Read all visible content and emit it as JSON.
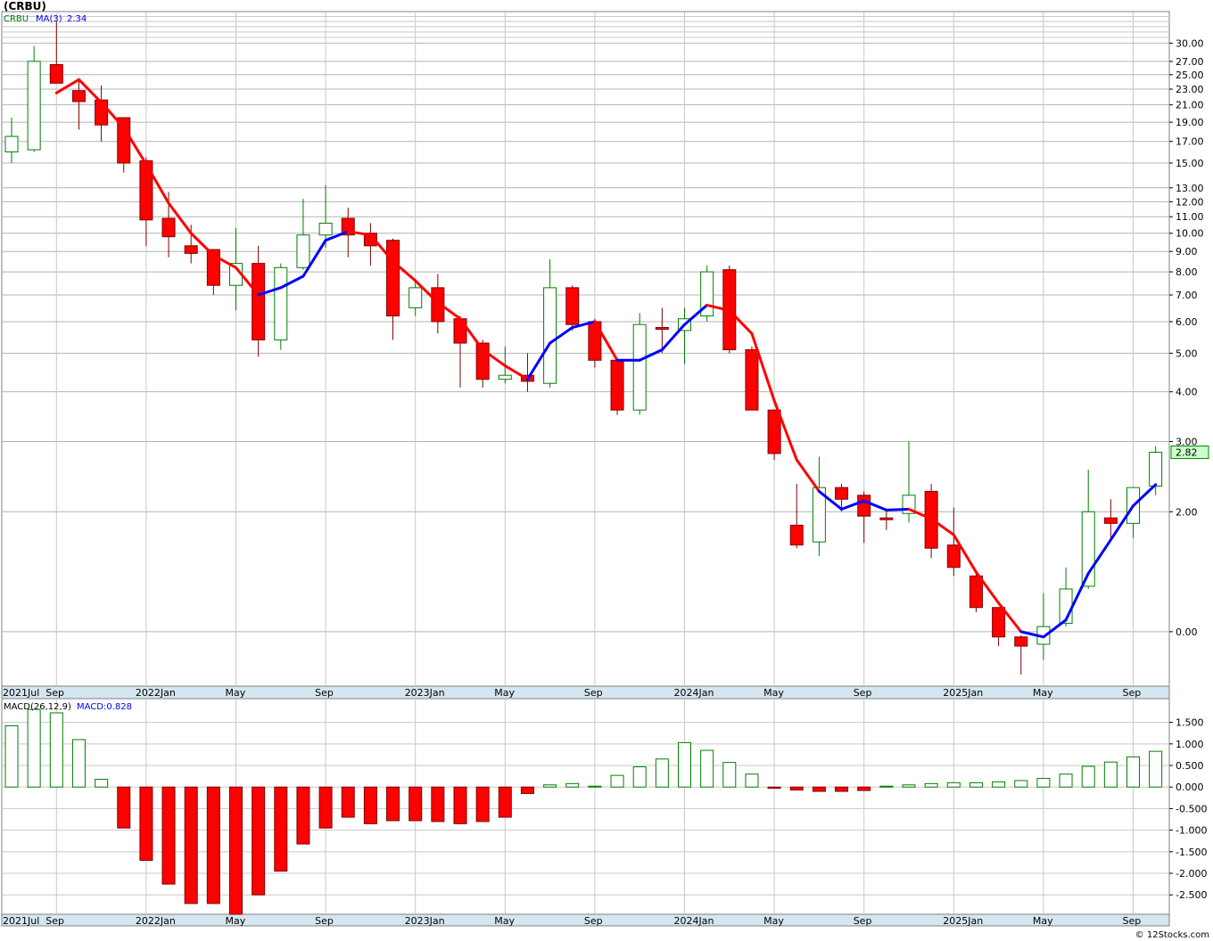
{
  "header": {
    "title": "(CRBU)"
  },
  "footer": {
    "credit": "© 12Stocks.com"
  },
  "chart_data": [
    {
      "type": "candlestick",
      "symbol": "CRBU",
      "interval": "monthly",
      "scale": "log",
      "legend": {
        "symbol_label": "CRBU",
        "ma_label": "MA(3)",
        "ma_value": "2.34"
      },
      "last_price_label": "2.82",
      "colors": {
        "down": "#ff0000",
        "up": "#008000",
        "ma_up": "#0000ff",
        "ma_down": "#ff0000"
      },
      "y_ticks": [
        {
          "v": 30.0,
          "label": "30.00"
        },
        {
          "v": 27.0,
          "label": "27.00"
        },
        {
          "v": 25.0,
          "label": "25.00"
        },
        {
          "v": 23.0,
          "label": "23.00"
        },
        {
          "v": 21.0,
          "label": "21.00"
        },
        {
          "v": 19.0,
          "label": "19.00"
        },
        {
          "v": 17.0,
          "label": "17.00"
        },
        {
          "v": 15.0,
          "label": "15.00"
        },
        {
          "v": 13.0,
          "label": "13.00"
        },
        {
          "v": 12.0,
          "label": "12.00"
        },
        {
          "v": 11.0,
          "label": "11.00"
        },
        {
          "v": 10.0,
          "label": "10.00"
        },
        {
          "v": 9.0,
          "label": "9.00"
        },
        {
          "v": 8.0,
          "label": "8.00"
        },
        {
          "v": 7.0,
          "label": "7.00"
        },
        {
          "v": 6.0,
          "label": "6.00"
        },
        {
          "v": 5.0,
          "label": "5.00"
        },
        {
          "v": 4.0,
          "label": "4.00"
        },
        {
          "v": 3.0,
          "label": "3.00"
        },
        {
          "v": 2.0,
          "label": "2.00"
        },
        {
          "v": 1.0,
          "label": "0.00"
        }
      ],
      "x_labels": [
        {
          "index": 0,
          "label": "2021Jul"
        },
        {
          "index": 2,
          "label": "Sep"
        },
        {
          "index": 6,
          "label": "2022Jan"
        },
        {
          "index": 10,
          "label": "May"
        },
        {
          "index": 14,
          "label": "Sep"
        },
        {
          "index": 18,
          "label": "2023Jan"
        },
        {
          "index": 22,
          "label": "May"
        },
        {
          "index": 26,
          "label": "Sep"
        },
        {
          "index": 30,
          "label": "2024Jan"
        },
        {
          "index": 34,
          "label": "May"
        },
        {
          "index": 38,
          "label": "Sep"
        },
        {
          "index": 42,
          "label": "2025Jan"
        },
        {
          "index": 46,
          "label": "May"
        },
        {
          "index": 50,
          "label": "Sep"
        }
      ],
      "candles": [
        {
          "o": 16.0,
          "h": 19.5,
          "l": 15.0,
          "c": 17.5
        },
        {
          "o": 16.2,
          "h": 29.5,
          "l": 16.0,
          "c": 27.0
        },
        {
          "o": 26.5,
          "h": 34.0,
          "l": 23.8,
          "c": 23.8
        },
        {
          "o": 22.8,
          "h": 24.5,
          "l": 18.2,
          "c": 21.4
        },
        {
          "o": 21.6,
          "h": 23.5,
          "l": 17.0,
          "c": 18.7
        },
        {
          "o": 19.5,
          "h": 19.5,
          "l": 14.2,
          "c": 15.0
        },
        {
          "o": 15.2,
          "h": 15.5,
          "l": 9.3,
          "c": 10.8
        },
        {
          "o": 10.9,
          "h": 12.7,
          "l": 8.7,
          "c": 9.8
        },
        {
          "o": 9.3,
          "h": 10.5,
          "l": 8.4,
          "c": 8.9
        },
        {
          "o": 9.1,
          "h": 9.1,
          "l": 7.0,
          "c": 7.4
        },
        {
          "o": 7.4,
          "h": 10.3,
          "l": 6.4,
          "c": 8.4
        },
        {
          "o": 8.4,
          "h": 9.3,
          "l": 4.9,
          "c": 5.4
        },
        {
          "o": 5.4,
          "h": 8.4,
          "l": 5.1,
          "c": 8.2
        },
        {
          "o": 8.2,
          "h": 12.2,
          "l": 8.1,
          "c": 9.9
        },
        {
          "o": 9.9,
          "h": 13.2,
          "l": 9.2,
          "c": 10.6
        },
        {
          "o": 10.9,
          "h": 11.6,
          "l": 8.7,
          "c": 9.9
        },
        {
          "o": 10.0,
          "h": 10.6,
          "l": 8.3,
          "c": 9.3
        },
        {
          "o": 9.6,
          "h": 9.7,
          "l": 5.4,
          "c": 6.2
        },
        {
          "o": 6.5,
          "h": 7.7,
          "l": 6.2,
          "c": 7.3
        },
        {
          "o": 7.3,
          "h": 7.9,
          "l": 5.6,
          "c": 6.0
        },
        {
          "o": 6.1,
          "h": 6.2,
          "l": 4.1,
          "c": 5.3
        },
        {
          "o": 5.3,
          "h": 5.4,
          "l": 4.1,
          "c": 4.3
        },
        {
          "o": 4.3,
          "h": 5.2,
          "l": 4.2,
          "c": 4.4
        },
        {
          "o": 4.4,
          "h": 5.0,
          "l": 4.0,
          "c": 4.25
        },
        {
          "o": 4.2,
          "h": 8.6,
          "l": 4.1,
          "c": 7.3
        },
        {
          "o": 7.3,
          "h": 7.4,
          "l": 5.7,
          "c": 5.9
        },
        {
          "o": 6.0,
          "h": 6.1,
          "l": 4.6,
          "c": 4.8
        },
        {
          "o": 4.8,
          "h": 4.8,
          "l": 3.5,
          "c": 3.6
        },
        {
          "o": 3.6,
          "h": 6.3,
          "l": 3.5,
          "c": 5.9
        },
        {
          "o": 5.8,
          "h": 6.5,
          "l": 5.0,
          "c": 5.75
        },
        {
          "o": 5.7,
          "h": 6.5,
          "l": 4.7,
          "c": 6.1
        },
        {
          "o": 6.2,
          "h": 8.3,
          "l": 6.0,
          "c": 8.0
        },
        {
          "o": 8.1,
          "h": 8.3,
          "l": 5.0,
          "c": 5.1
        },
        {
          "o": 5.1,
          "h": 5.2,
          "l": 3.6,
          "c": 3.6
        },
        {
          "o": 3.6,
          "h": 3.6,
          "l": 2.7,
          "c": 2.8
        },
        {
          "o": 1.85,
          "h": 2.35,
          "l": 1.62,
          "c": 1.65
        },
        {
          "o": 1.68,
          "h": 2.75,
          "l": 1.55,
          "c": 2.3
        },
        {
          "o": 2.3,
          "h": 2.35,
          "l": 2.0,
          "c": 2.15
        },
        {
          "o": 2.2,
          "h": 2.25,
          "l": 1.67,
          "c": 1.95
        },
        {
          "o": 1.93,
          "h": 2.02,
          "l": 1.8,
          "c": 1.92
        },
        {
          "o": 1.98,
          "h": 3.0,
          "l": 1.88,
          "c": 2.2
        },
        {
          "o": 2.25,
          "h": 2.35,
          "l": 1.53,
          "c": 1.62
        },
        {
          "o": 1.65,
          "h": 2.05,
          "l": 1.38,
          "c": 1.45
        },
        {
          "o": 1.38,
          "h": 1.42,
          "l": 1.12,
          "c": 1.15
        },
        {
          "o": 1.15,
          "h": 1.15,
          "l": 0.92,
          "c": 0.97
        },
        {
          "o": 0.97,
          "h": 0.98,
          "l": 0.78,
          "c": 0.92
        },
        {
          "o": 0.93,
          "h": 1.25,
          "l": 0.85,
          "c": 1.03
        },
        {
          "o": 1.05,
          "h": 1.45,
          "l": 1.03,
          "c": 1.28
        },
        {
          "o": 1.3,
          "h": 2.55,
          "l": 1.28,
          "c": 2.0
        },
        {
          "o": 1.93,
          "h": 2.15,
          "l": 1.72,
          "c": 1.87
        },
        {
          "o": 1.87,
          "h": 2.3,
          "l": 1.72,
          "c": 2.3
        },
        {
          "o": 2.32,
          "h": 2.92,
          "l": 2.2,
          "c": 2.82
        }
      ],
      "ma3": [
        null,
        null,
        22.5,
        24.3,
        21.3,
        18.4,
        14.9,
        11.9,
        10.0,
        8.8,
        8.2,
        7.0,
        7.3,
        7.8,
        9.6,
        10.1,
        9.9,
        8.5,
        7.6,
        6.7,
        6.1,
        5.1,
        4.65,
        4.3,
        5.3,
        5.8,
        6.0,
        4.8,
        4.8,
        5.1,
        5.9,
        6.6,
        6.4,
        5.6,
        3.8,
        2.7,
        2.25,
        2.03,
        2.13,
        2.02,
        2.03,
        1.92,
        1.75,
        1.41,
        1.18,
        1.0,
        0.97,
        1.07,
        1.4,
        1.7,
        2.07,
        2.34
      ],
      "ma_colors": [
        null,
        null,
        "b",
        "r",
        "r",
        "r",
        "r",
        "r",
        "r",
        "r",
        "r",
        "r",
        "b",
        "b",
        "b",
        "b",
        "r",
        "r",
        "r",
        "r",
        "r",
        "r",
        "r",
        "r",
        "b",
        "b",
        "b",
        "r",
        "b",
        "b",
        "b",
        "b",
        "r",
        "r",
        "r",
        "r",
        "r",
        "b",
        "b",
        "b",
        "b",
        "r",
        "r",
        "r",
        "r",
        "r",
        "b",
        "b",
        "b",
        "b",
        "b",
        "b"
      ]
    },
    {
      "type": "bar",
      "name": "MACD(26,12,9)",
      "legend": {
        "label": "MACD(26,12,9)",
        "value_label": "MACD:0.828"
      },
      "y_ticks": [
        {
          "v": 1.5,
          "label": "1.500"
        },
        {
          "v": 1.0,
          "label": "1.000"
        },
        {
          "v": 0.5,
          "label": "0.500"
        },
        {
          "v": 0.0,
          "label": "0.000"
        },
        {
          "v": -0.5,
          "label": "-0.500"
        },
        {
          "v": -1.0,
          "label": "-1.000"
        },
        {
          "v": -1.5,
          "label": "-1.500"
        },
        {
          "v": -2.0,
          "label": "-2.000"
        },
        {
          "v": -2.5,
          "label": "-2.500"
        }
      ],
      "values": [
        1.42,
        1.8,
        1.72,
        1.1,
        0.18,
        -0.95,
        -1.7,
        -2.25,
        -2.7,
        -2.7,
        -2.95,
        -2.5,
        -1.95,
        -1.32,
        -0.95,
        -0.7,
        -0.85,
        -0.78,
        -0.78,
        -0.8,
        -0.85,
        -0.8,
        -0.7,
        -0.15,
        0.05,
        0.08,
        0.02,
        0.27,
        0.47,
        0.65,
        1.03,
        0.85,
        0.57,
        0.3,
        -0.03,
        -0.07,
        -0.1,
        -0.1,
        -0.08,
        0.02,
        0.05,
        0.08,
        0.1,
        0.1,
        0.12,
        0.15,
        0.2,
        0.3,
        0.48,
        0.58,
        0.7,
        0.828
      ]
    }
  ]
}
